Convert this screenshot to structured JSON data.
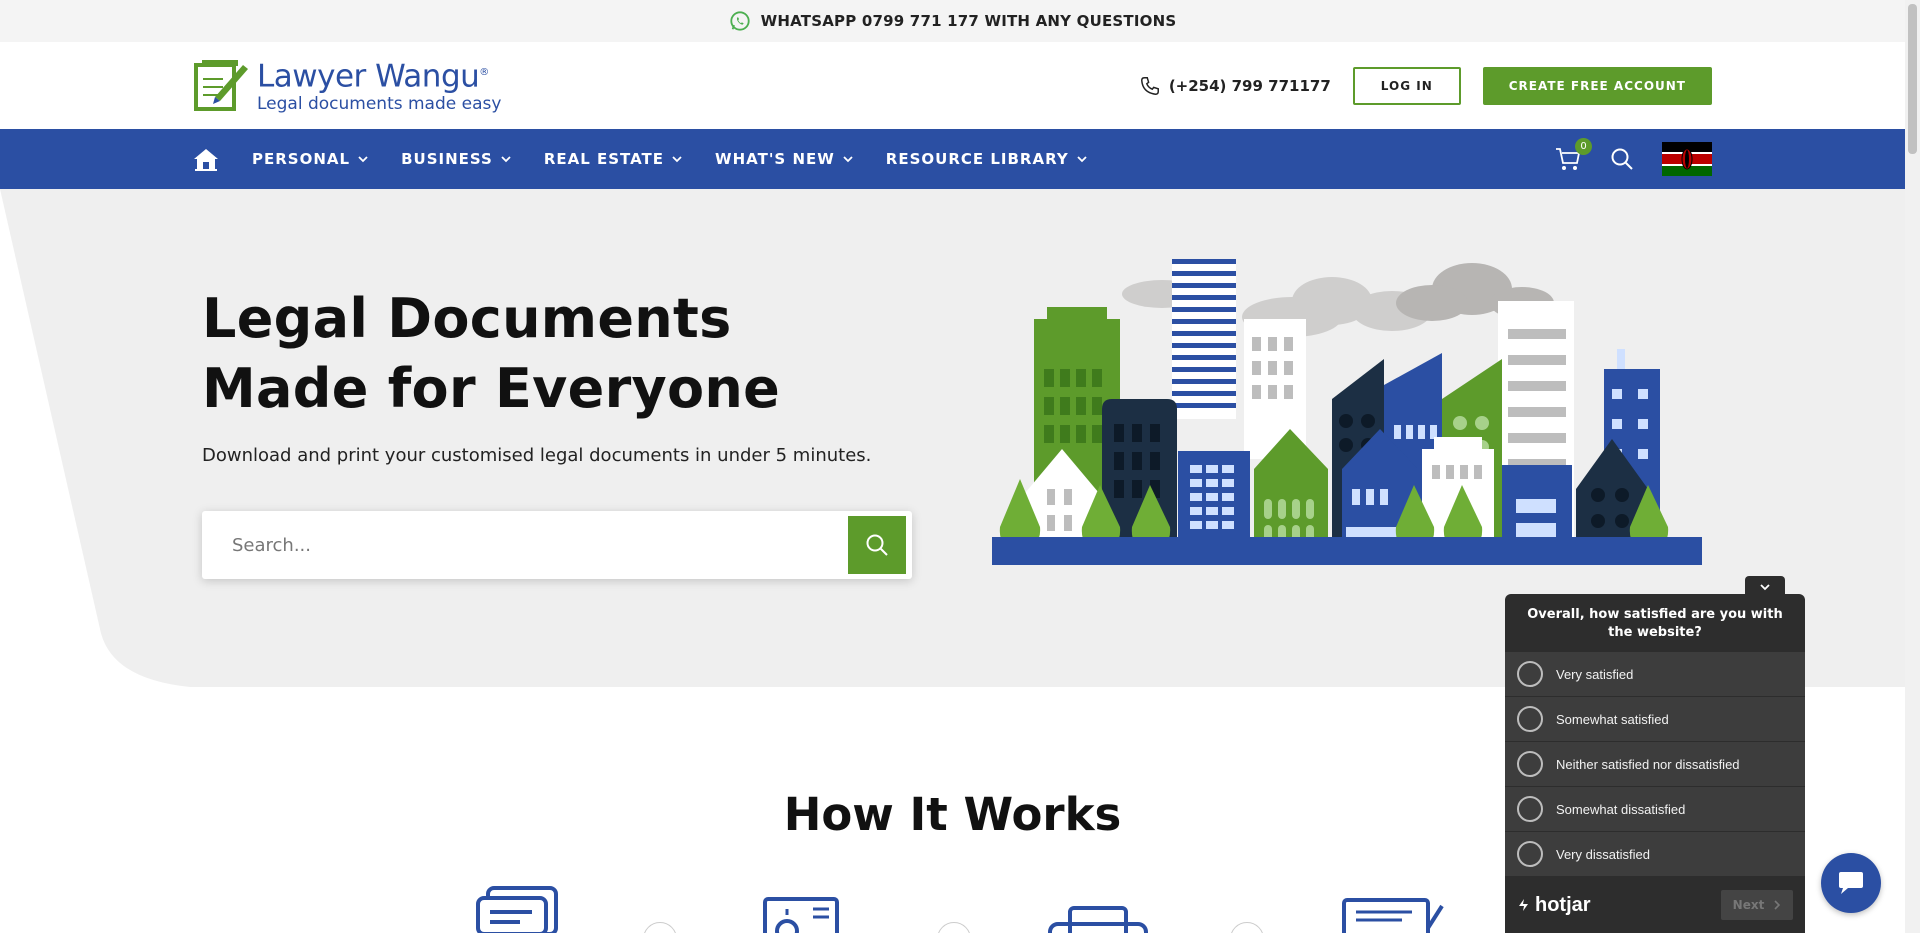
{
  "topbar": {
    "text": "WHATSAPP 0799 771 177 WITH ANY QUESTIONS",
    "icon": "whatsapp-icon"
  },
  "header": {
    "logo_name": "Lawyer Wangu",
    "logo_mark": "®",
    "logo_tagline": "Legal documents made easy",
    "phone": "(+254) 799 771177",
    "login_label": "LOG IN",
    "create_label": "CREATE FREE ACCOUNT"
  },
  "nav": {
    "items": [
      {
        "label": "PERSONAL"
      },
      {
        "label": "BUSINESS"
      },
      {
        "label": "REAL ESTATE"
      },
      {
        "label": "WHAT'S NEW"
      },
      {
        "label": "RESOURCE LIBRARY"
      }
    ],
    "cart_count": "0"
  },
  "hero": {
    "title_line1": "Legal Documents",
    "title_line2": "Made for Everyone",
    "subtitle": "Download and print your customised legal documents in under 5 minutes.",
    "search_placeholder": "Search..."
  },
  "how_it_works": {
    "title": "How It Works"
  },
  "survey": {
    "question": "Overall, how satisfied are you with the website?",
    "options": [
      {
        "label": "Very satisfied"
      },
      {
        "label": "Somewhat satisfied"
      },
      {
        "label": "Neither satisfied nor dissatisfied"
      },
      {
        "label": "Somewhat dissatisfied"
      },
      {
        "label": "Very dissatisfied"
      }
    ],
    "brand": "hotjar",
    "next_label": "Next"
  },
  "colors": {
    "brand_blue": "#2b4fa3",
    "brand_green": "#5d9b2b",
    "survey_bg": "#2d2d2d"
  }
}
